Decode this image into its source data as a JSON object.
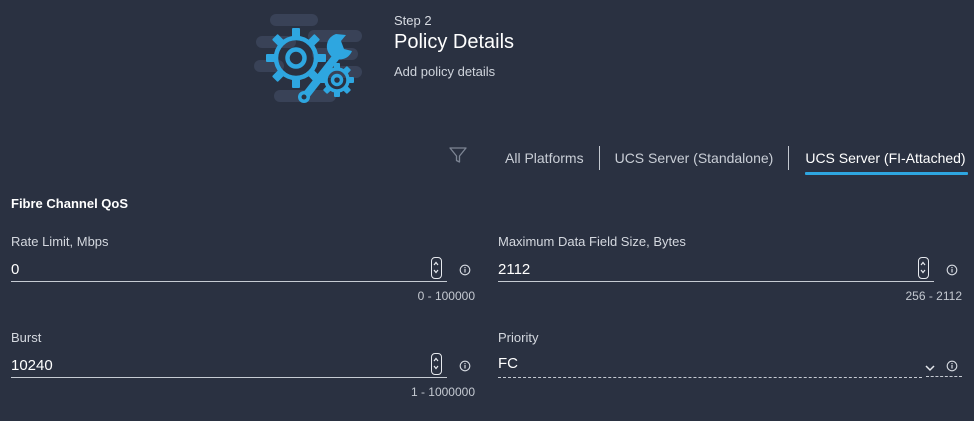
{
  "header": {
    "step": "Step 2",
    "title": "Policy Details",
    "subtitle": "Add policy details"
  },
  "tabs": [
    {
      "label": "All Platforms",
      "active": false
    },
    {
      "label": "UCS Server (Standalone)",
      "active": false
    },
    {
      "label": "UCS Server (FI-Attached)",
      "active": true
    }
  ],
  "section": {
    "title": "Fibre Channel QoS"
  },
  "fields": {
    "rate_limit": {
      "label": "Rate Limit, Mbps",
      "value": "0",
      "range": "0 - 100000"
    },
    "max_data_field": {
      "label": "Maximum Data Field Size, Bytes",
      "value": "2112",
      "range": "256 - 2112"
    },
    "burst": {
      "label": "Burst",
      "value": "10240",
      "range": "1 - 1000000"
    },
    "priority": {
      "label": "Priority",
      "value": "FC"
    }
  },
  "icons": {
    "hero": "gear-wrench-icon",
    "filter": "filter-icon",
    "stepper": "stepper-icon",
    "info": "info-icon",
    "chevron": "chevron-down-icon"
  },
  "colors": {
    "background": "#2a3141",
    "accent": "#2ea6e0",
    "text": "#ffffff"
  }
}
